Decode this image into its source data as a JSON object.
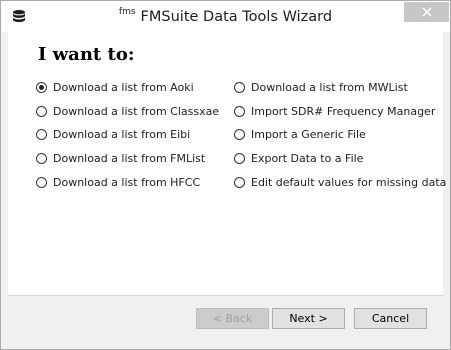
{
  "window": {
    "title_prefix": "fms",
    "title": "FMSuite Data Tools Wizard",
    "app_icon": "database-icon",
    "close_icon": "close-icon"
  },
  "wizard": {
    "heading": "I want to:",
    "options": [
      {
        "label": "Download a list from Aoki",
        "checked": true
      },
      {
        "label": "Download a list from Classxae",
        "checked": false
      },
      {
        "label": "Download a list from Eibi",
        "checked": false
      },
      {
        "label": "Download a list from FMList",
        "checked": false
      },
      {
        "label": "Download a list from HFCC",
        "checked": false
      },
      {
        "label": "Download a list from MWList",
        "checked": false
      },
      {
        "label": "Import SDR# Frequency Manager",
        "checked": false
      },
      {
        "label": "Import a Generic File",
        "checked": false
      },
      {
        "label": "Export Data to a File",
        "checked": false
      },
      {
        "label": "Edit default values for missing data",
        "checked": false
      }
    ]
  },
  "buttons": {
    "back": {
      "label": "< Back",
      "enabled": false
    },
    "next": {
      "label": "Next >",
      "enabled": true
    },
    "cancel": {
      "label": "Cancel",
      "enabled": true
    }
  }
}
